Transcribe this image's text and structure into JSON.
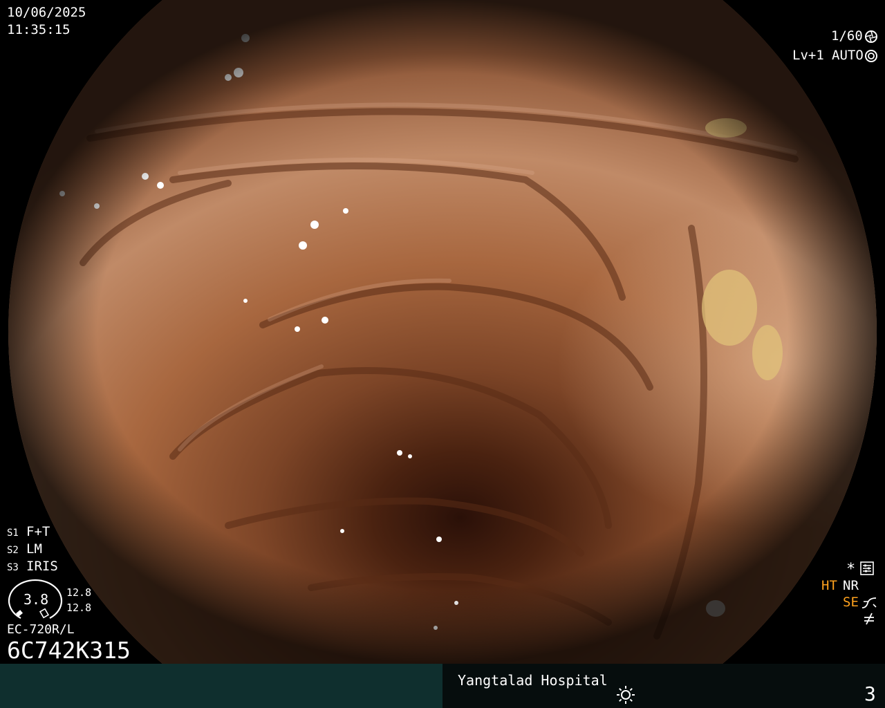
{
  "overlay": {
    "date": "10/06/2025",
    "time": "11:35:15",
    "shutter": "1/60",
    "level": "Lv+1",
    "iris_mode": "AUTO",
    "switches": [
      {
        "key": "S1",
        "value": "F+T"
      },
      {
        "key": "S2",
        "value": "LM"
      },
      {
        "key": "S3",
        "value": "IRIS"
      }
    ],
    "gauge": {
      "center": "3.8",
      "upper": "12.8",
      "lower": "12.8"
    },
    "scope_model": "EC-720R/L",
    "serial": "6C742K315",
    "right_indicators": {
      "star": "*",
      "ht": "HT",
      "nr": "NR",
      "se": "SE"
    }
  },
  "footer": {
    "hospital": "Yangtalad Hospital",
    "number": "3"
  },
  "colors": {
    "background": "#000000",
    "mucosa_base": "#a8673f",
    "mucosa_dark": "#2a1008",
    "highlight_orange": "#ffa21e",
    "footer_left": "#0f2f2e",
    "footer_right": "#060d0d"
  },
  "icons": {
    "shutter": "aperture-icon",
    "iris": "iris-icon",
    "settings": "menu-settings-icon",
    "se": "se-curve-icon",
    "freeze": "not-equal-icon",
    "light": "sun-icon"
  }
}
